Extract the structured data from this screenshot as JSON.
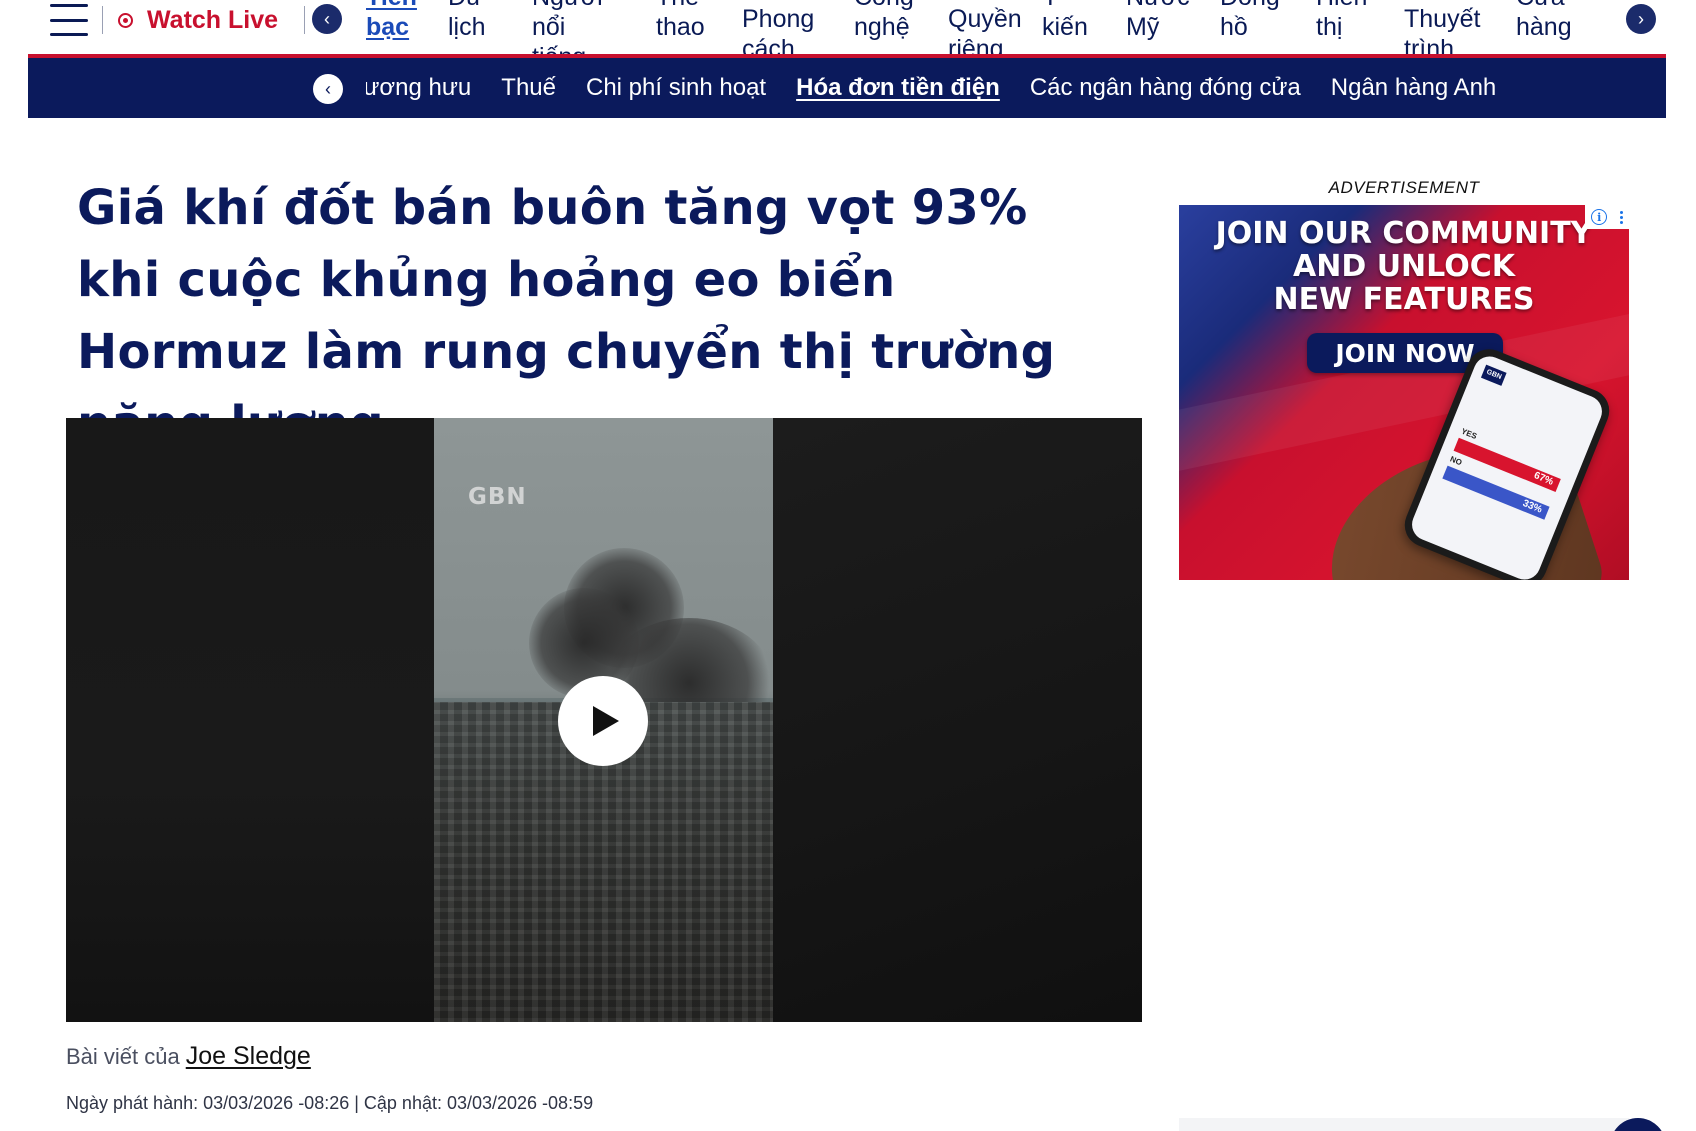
{
  "topnav": {
    "watch_live": "Watch Live",
    "prev_arrow": "‹",
    "next_arrow": "›",
    "items": [
      {
        "label": "Tiền bạc",
        "active": true
      },
      {
        "label": "Du lịch"
      },
      {
        "label": "Người nổi tiếng"
      },
      {
        "label": "Thể thao"
      },
      {
        "label": "Phong cách sống"
      },
      {
        "label": "Công nghệ"
      },
      {
        "label": "Quyền riêng tư"
      },
      {
        "label": "Ý kiến"
      },
      {
        "label": "Nước Mỹ"
      },
      {
        "label": "Đồng hồ"
      },
      {
        "label": "Hiển thị"
      },
      {
        "label": "Thuyết trình"
      },
      {
        "label": "Cửa hàng"
      }
    ]
  },
  "subnav": {
    "prev_arrow": "‹",
    "items": [
      {
        "label": "Lương hưu"
      },
      {
        "label": "Thuế"
      },
      {
        "label": "Chi phí sinh hoạt"
      },
      {
        "label": "Hóa đơn tiền điện",
        "active": true
      },
      {
        "label": "Các ngân hàng đóng cửa"
      },
      {
        "label": "Ngân hàng Anh"
      }
    ]
  },
  "article": {
    "headline": "Giá khí đốt bán buôn tăng vọt 93% khi cuộc khủng hoảng eo biển Hormuz làm rung chuyển thị trường năng lượng.",
    "video_watermark": "GBN",
    "byline_prefix": "Bài viết của",
    "author": "Joe Sledge",
    "dates": "Ngày phát hành: 03/03/2026 -08:26 | Cập nhật: 03/03/2026 -08:59"
  },
  "sidebar": {
    "ad_label": "ADVERTISEMENT",
    "ad": {
      "headline_lines": [
        "JOIN OUR COMMUNITY",
        "AND UNLOCK",
        "NEW FEATURES"
      ],
      "cta": "JOIN NOW",
      "phone": {
        "logo": "GBN",
        "yes": "YES",
        "no": "NO",
        "yes_pct": "67%",
        "no_pct": "33%"
      },
      "info_glyph": "i"
    }
  },
  "colors": {
    "navy": "#0b1a5c",
    "red": "#c8102e",
    "link_blue": "#1b4bb8"
  }
}
